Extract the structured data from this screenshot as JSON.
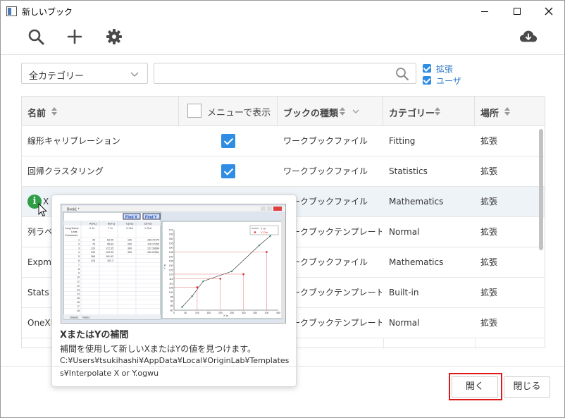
{
  "window": {
    "title": "新しいブック",
    "minimize_glyph": "—",
    "maximize_glyph": "☐",
    "close_glyph": "✕"
  },
  "toolbar": {
    "search_icon": "search-icon",
    "add_icon": "plus-icon",
    "settings_icon": "gear-icon",
    "download_icon": "cloud-download-icon"
  },
  "filters": {
    "category_value": "全カテゴリー",
    "search_value": "",
    "search_placeholder": "",
    "checkboxes": [
      {
        "label": "拡張",
        "checked": true
      },
      {
        "label": "ユーザ",
        "checked": true
      }
    ]
  },
  "table": {
    "headers": {
      "name": "名前",
      "menu": "メニューで表示",
      "type": "ブックの種類",
      "category": "カテゴリー",
      "location": "場所"
    },
    "rows": [
      {
        "name": "線形キャリブレーション",
        "menu": true,
        "type": "ワークブックファイル",
        "category": "Fitting",
        "location": "拡張"
      },
      {
        "name": "回帰クラスタリング",
        "menu": true,
        "type": "ワークブックファイル",
        "category": "Statistics",
        "location": "拡張"
      },
      {
        "name": "X",
        "menu": false,
        "type": "ワークブックファイル",
        "category": "Mathematics",
        "location": "拡張"
      },
      {
        "name": "列ラベ",
        "menu": false,
        "type": "ワークブックテンプレート",
        "category": "Normal",
        "location": "拡張"
      },
      {
        "name": "Expm",
        "menu": false,
        "type": "ワークブックファイル",
        "category": "Mathematics",
        "location": "拡張"
      },
      {
        "name": "Stats b",
        "menu": false,
        "type": "ワークブックテンプレート",
        "category": "Built-in",
        "location": "拡張"
      },
      {
        "name": "OneXM",
        "menu": false,
        "type": "ワークブックテンプレート",
        "category": "Normal",
        "location": "拡張"
      }
    ]
  },
  "tooltip": {
    "title": "XまたはYの補間",
    "description": "補間を使用して新しいXまたはYの値を見つけます。",
    "path_line1": "C:¥Users¥tsukihashi¥AppData¥Local¥OriginLab¥Templates",
    "path_line2": "s¥Interpolate X or Y.ogwu",
    "preview": {
      "window_title": "Book1 *",
      "find_x": "Find X",
      "find_y": "Find Y",
      "columns": [
        "A(X1)",
        "B(Y1)",
        "C(X2)",
        "D(Y2)"
      ],
      "row_labels": [
        "Long Name",
        "Units",
        "Comments"
      ],
      "sublabels": [
        "X In",
        "Y In",
        "X Out",
        "Y Out"
      ],
      "col_a": [
        "35",
        "78",
        "126",
        "249",
        "368",
        "416"
      ],
      "col_b": [
        "83.45",
        "95.63",
        "172.35",
        "123.39",
        "161.62",
        "162.2"
      ],
      "col_c": [
        "100",
        "200",
        "300",
        "400"
      ],
      "col_d": [
        "165.72475",
        "115.17393",
        "137.33664",
        "160.22561"
      ],
      "row_numbers": [
        "1",
        "2",
        "3",
        "4",
        "5",
        "6",
        "7",
        "8",
        "9",
        "10",
        "11",
        "12",
        "13",
        "14",
        "15",
        "16",
        "17",
        "18"
      ],
      "sheet_tab": "Sheet1",
      "notes_tab": "Notes",
      "legend": [
        "Y In",
        "Y Out"
      ],
      "xlabel": "X In",
      "ylabel": "Y In",
      "yticks": [
        "170",
        "165",
        "160",
        "155",
        "150",
        "145",
        "140",
        "135",
        "130",
        "125",
        "120",
        "115",
        "110",
        "105",
        "100",
        "95",
        "90",
        "85",
        "80"
      ],
      "xticks": [
        "0",
        "50",
        "100",
        "150",
        "200",
        "250",
        "300",
        "350",
        "400",
        "450"
      ]
    }
  },
  "buttons": {
    "open": "開く",
    "close": "閉じる"
  },
  "colors": {
    "accent": "#2f8de4",
    "highlight": "#e01818",
    "info_icon": "#2e9e47"
  }
}
